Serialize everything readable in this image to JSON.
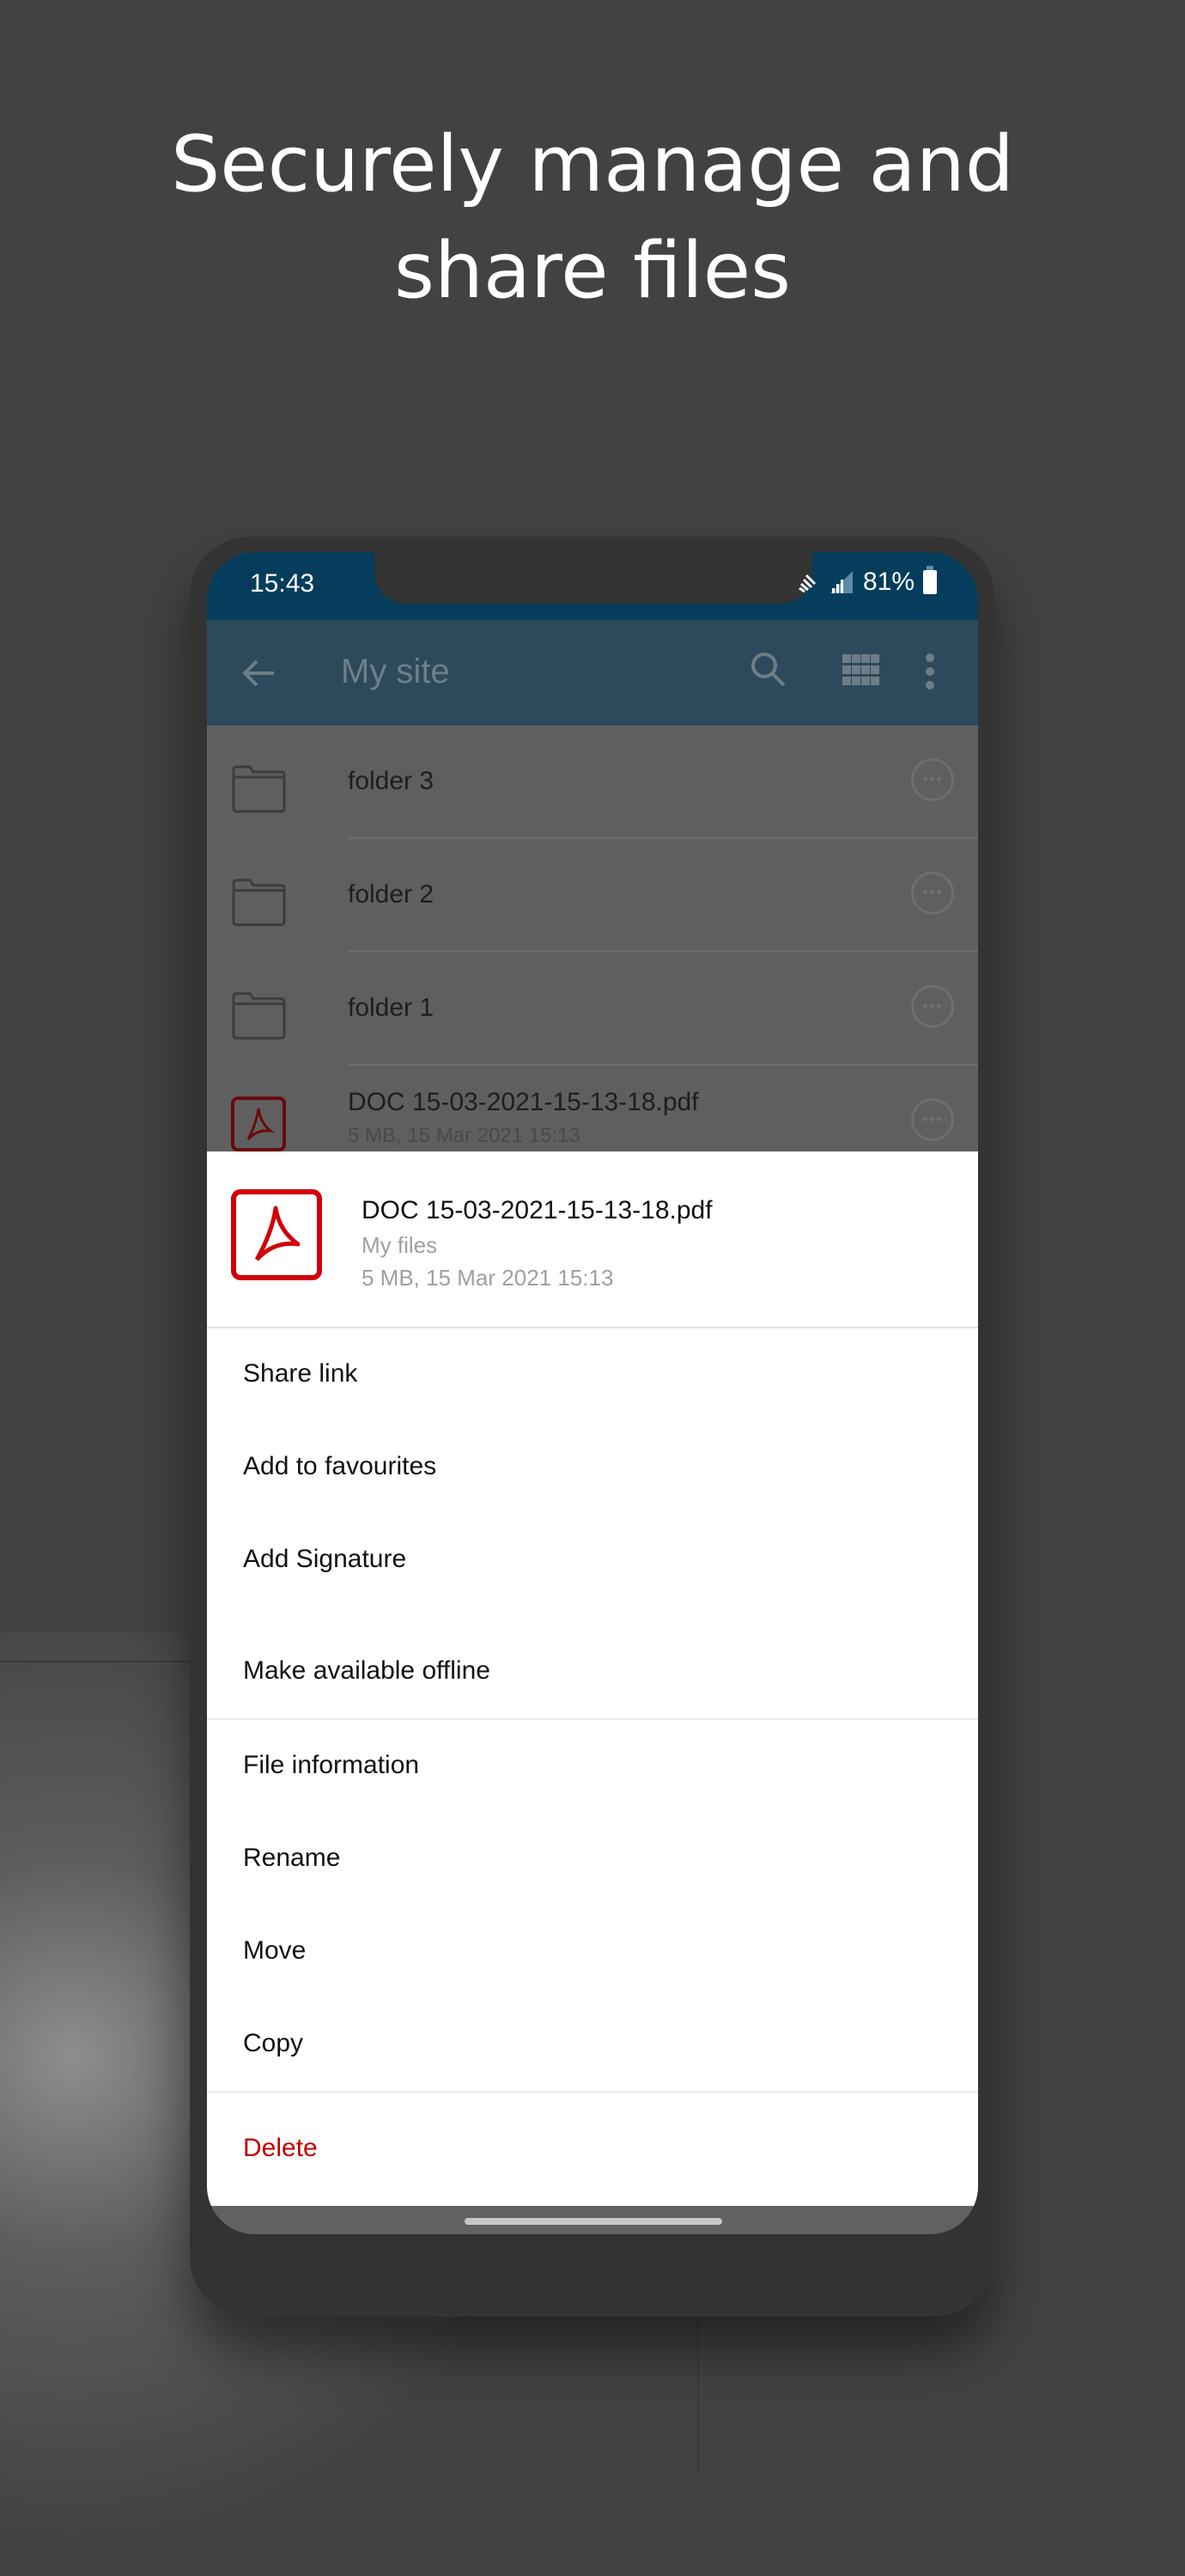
{
  "headline": {
    "line1": "Securely manage and",
    "line2": "share files"
  },
  "status_bar": {
    "time": "15:43",
    "battery": "81%",
    "icons": [
      "wifi-icon",
      "signal-icon",
      "battery-icon"
    ]
  },
  "app_bar": {
    "title": "My site",
    "back_icon": "arrow-left-icon",
    "actions": [
      "search-icon",
      "grid-view-icon",
      "more-vertical-icon"
    ]
  },
  "file_list": {
    "items": [
      {
        "name": "folder 3",
        "type": "folder"
      },
      {
        "name": "folder 2",
        "type": "folder"
      },
      {
        "name": "folder 1",
        "type": "folder"
      },
      {
        "name": "DOC 15-03-2021-15-13-18.pdf",
        "type": "pdf",
        "sub": "5 MB, 15 Mar 2021 15:13"
      }
    ]
  },
  "bottom_sheet": {
    "file": {
      "name": "DOC 15-03-2021-15-13-18.pdf",
      "location": "My files",
      "meta": "5 MB, 15 Mar 2021 15:13"
    },
    "group1": [
      "Share link",
      "Add to favourites",
      "Add Signature",
      "Make available offline"
    ],
    "group2": [
      "File information",
      "Rename",
      "Move",
      "Copy"
    ],
    "delete_label": "Delete",
    "colors": {
      "danger": "#c00000",
      "pdf": "#d0000a",
      "statusbar": "#063d5c"
    }
  }
}
